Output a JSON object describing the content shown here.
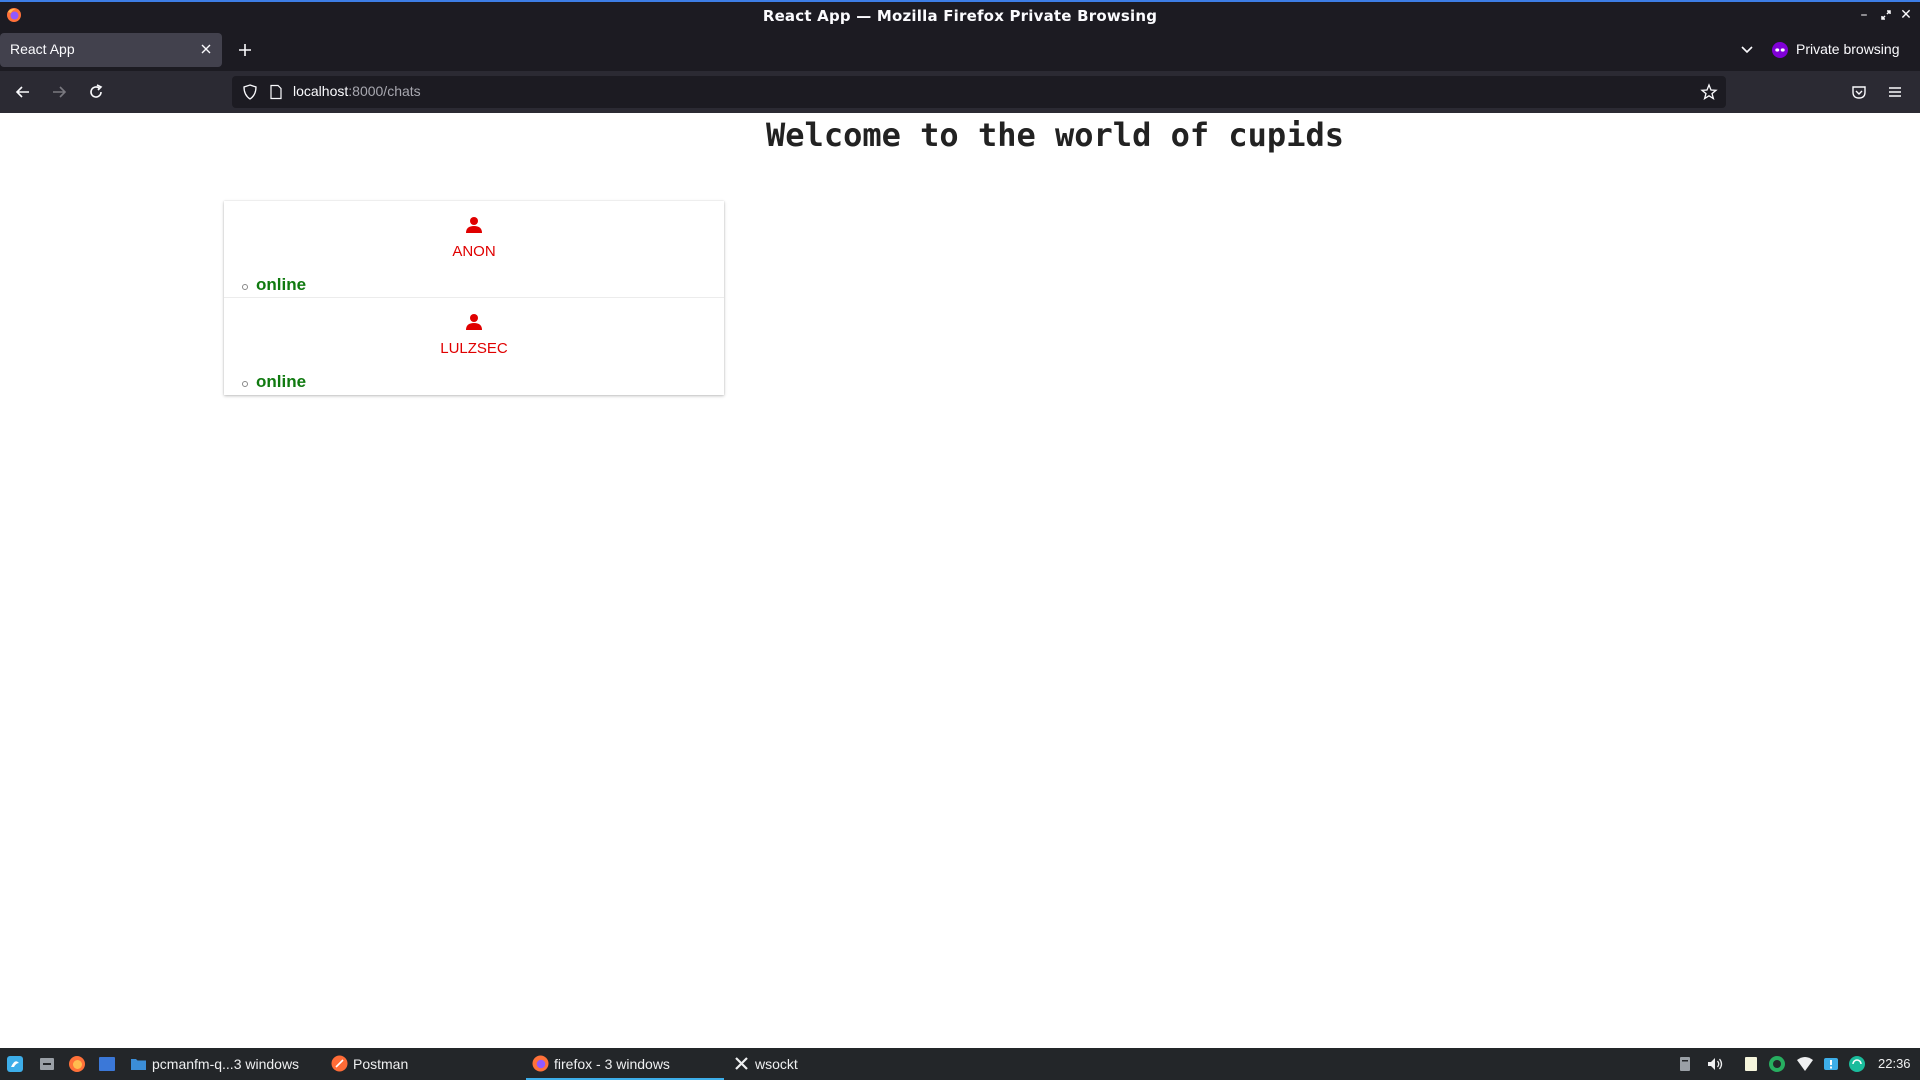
{
  "window": {
    "title": "React App — Mozilla Firefox Private Browsing"
  },
  "tabs": [
    {
      "label": "React App",
      "active": true
    }
  ],
  "toolbar": {
    "private_label": "Private browsing",
    "url_host": "localhost",
    "url_path": ":8000/chats"
  },
  "page": {
    "heading": "Welcome to the world of cupids",
    "users": [
      {
        "name": "ANON",
        "status": "online"
      },
      {
        "name": "LULZSEC",
        "status": "online"
      }
    ]
  },
  "taskbar": {
    "tasks": [
      {
        "label": "pcmanfm-q...3 windows",
        "icon": "folder-icon"
      },
      {
        "label": "Postman",
        "icon": "postman-icon"
      },
      {
        "label": "firefox - 3 windows",
        "icon": "firefox-icon",
        "active": true
      },
      {
        "label": "wsockt",
        "icon": "x-app-icon"
      }
    ],
    "clock": "22:36"
  },
  "colors": {
    "accent": "#3d7ee6",
    "username": "#e00000",
    "status_online": "#107a10",
    "chrome_dark": "#1c1b22"
  }
}
